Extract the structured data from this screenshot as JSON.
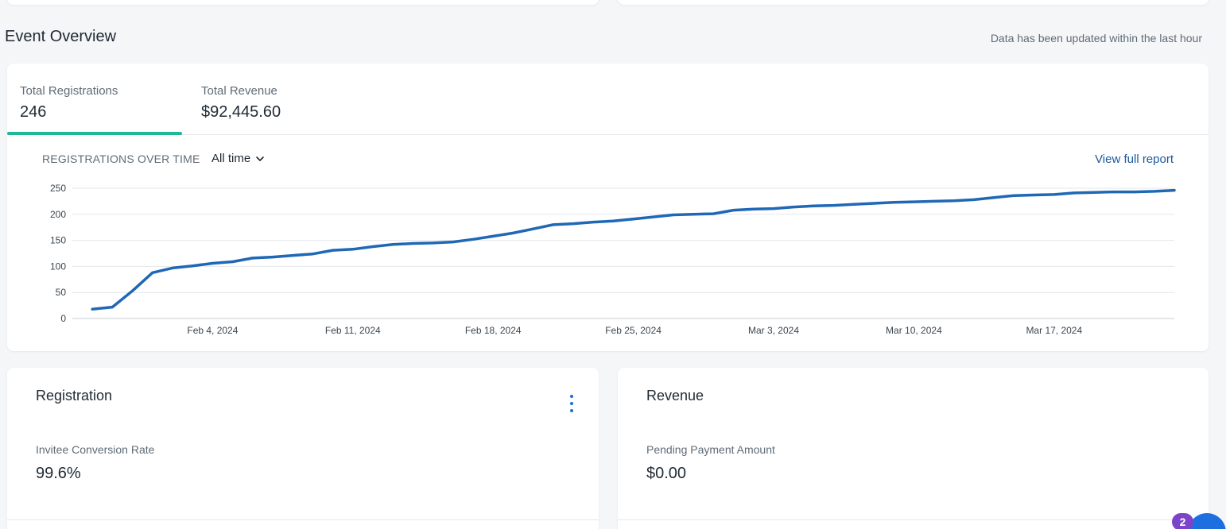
{
  "header": {
    "title": "Event Overview",
    "update_note": "Data has been updated within the last hour"
  },
  "kpis": {
    "registrations": {
      "label": "Total Registrations",
      "value": "246"
    },
    "revenue": {
      "label": "Total Revenue",
      "value": "$92,445.60"
    }
  },
  "chart_section": {
    "label": "REGISTRATIONS OVER TIME",
    "range_value": "All time",
    "full_report_link": "View full report"
  },
  "chart_data": {
    "type": "line",
    "title": "REGISTRATIONS OVER TIME",
    "xlabel": "",
    "ylabel": "",
    "ylim": [
      0,
      250
    ],
    "yticks": [
      0,
      50,
      100,
      150,
      200,
      250
    ],
    "x_tick_labels": [
      {
        "date": "2024-02-04",
        "label": "Feb 4, 2024"
      },
      {
        "date": "2024-02-11",
        "label": "Feb 11, 2024"
      },
      {
        "date": "2024-02-18",
        "label": "Feb 18, 2024"
      },
      {
        "date": "2024-02-25",
        "label": "Feb 25, 2024"
      },
      {
        "date": "2024-03-03",
        "label": "Mar 3, 2024"
      },
      {
        "date": "2024-03-10",
        "label": "Mar 10, 2024"
      },
      {
        "date": "2024-03-17",
        "label": "Mar 17, 2024"
      }
    ],
    "xlim": [
      "2024-01-28",
      "2024-03-23"
    ],
    "grid": true,
    "line_color": "#1f68b5",
    "series": [
      {
        "x": [
          "2024-01-29",
          "2024-01-30",
          "2024-01-31",
          "2024-02-01",
          "2024-02-02",
          "2024-02-03",
          "2024-02-04",
          "2024-02-05",
          "2024-02-06",
          "2024-02-07",
          "2024-02-08",
          "2024-02-09",
          "2024-02-10",
          "2024-02-11",
          "2024-02-12",
          "2024-02-13",
          "2024-02-14",
          "2024-02-15",
          "2024-02-16",
          "2024-02-17",
          "2024-02-18",
          "2024-02-19",
          "2024-02-20",
          "2024-02-21",
          "2024-02-22",
          "2024-02-23",
          "2024-02-24",
          "2024-02-25",
          "2024-02-26",
          "2024-02-27",
          "2024-02-28",
          "2024-02-29",
          "2024-03-01",
          "2024-03-02",
          "2024-03-03",
          "2024-03-04",
          "2024-03-05",
          "2024-03-06",
          "2024-03-07",
          "2024-03-08",
          "2024-03-09",
          "2024-03-10",
          "2024-03-11",
          "2024-03-12",
          "2024-03-13",
          "2024-03-14",
          "2024-03-15",
          "2024-03-16",
          "2024-03-17",
          "2024-03-18",
          "2024-03-19",
          "2024-03-20",
          "2024-03-21",
          "2024-03-22",
          "2024-03-23"
        ],
        "values": [
          18,
          22,
          53,
          88,
          97,
          101,
          106,
          109,
          116,
          118,
          121,
          124,
          131,
          133,
          138,
          142,
          144,
          145,
          147,
          152,
          158,
          164,
          172,
          180,
          182,
          185,
          187,
          191,
          195,
          199,
          200,
          201,
          208,
          210,
          211,
          214,
          216,
          217,
          219,
          221,
          223,
          224,
          225,
          226,
          228,
          232,
          236,
          237,
          238,
          241,
          242,
          243,
          243,
          244,
          246
        ]
      }
    ]
  },
  "registration_card": {
    "title": "Registration",
    "metric_label": "Invitee Conversion Rate",
    "metric_value": "99.6%"
  },
  "revenue_card": {
    "title": "Revenue",
    "metric_label": "Pending Payment Amount",
    "metric_value": "$0.00"
  },
  "chat": {
    "badge_count": "2"
  }
}
